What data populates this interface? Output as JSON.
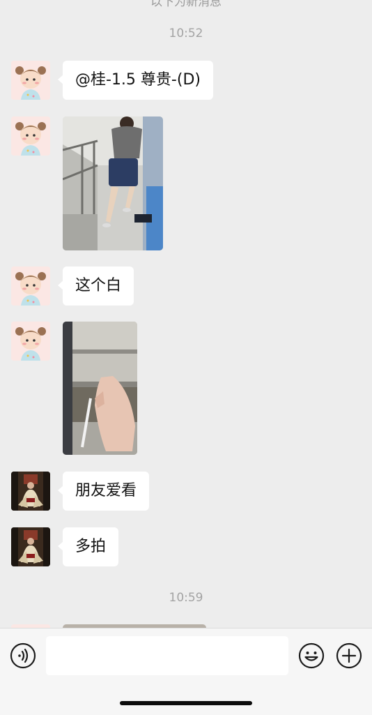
{
  "chat": {
    "top_clipped_text": "以下为新消息",
    "timestamps": [
      "10:52",
      "10:59"
    ],
    "messages": [
      {
        "type": "text",
        "text": "@桂-1.5 尊贵-(D)"
      },
      {
        "type": "image",
        "description": "photo"
      },
      {
        "type": "text",
        "text": "这个白"
      },
      {
        "type": "image",
        "description": "photo"
      },
      {
        "type": "text",
        "text": "朋友爱看"
      },
      {
        "type": "text",
        "text": "多拍"
      }
    ]
  },
  "input_bar": {
    "placeholder": "",
    "icons": [
      "voice-icon",
      "emoji-icon",
      "plus-icon"
    ]
  },
  "colors": {
    "background": "#ededed",
    "bubble": "#ffffff",
    "timestamp": "#a3a3a3"
  }
}
